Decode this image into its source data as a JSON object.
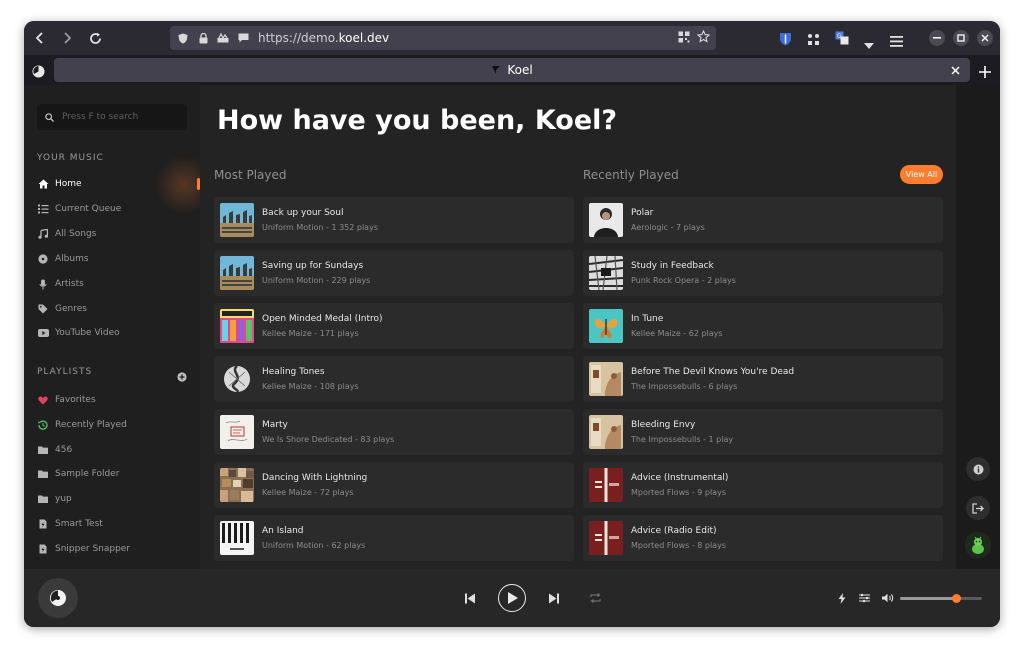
{
  "browser": {
    "url_prefix": "https://demo.",
    "url_host": "koel.dev",
    "tab_title": "Koel"
  },
  "sidebar": {
    "search_placeholder": "Press F to search",
    "your_music_title": "YOUR MUSIC",
    "music_items": [
      {
        "label": "Home",
        "icon": "home-icon"
      },
      {
        "label": "Current Queue",
        "icon": "queue-icon"
      },
      {
        "label": "All Songs",
        "icon": "music-note-icon"
      },
      {
        "label": "Albums",
        "icon": "disc-icon"
      },
      {
        "label": "Artists",
        "icon": "microphone-icon"
      },
      {
        "label": "Genres",
        "icon": "tag-icon"
      },
      {
        "label": "YouTube Video",
        "icon": "youtube-icon"
      }
    ],
    "playlists_title": "PLAYLISTS",
    "playlists": [
      {
        "label": "Favorites",
        "icon": "heart-icon"
      },
      {
        "label": "Recently Played",
        "icon": "history-icon"
      },
      {
        "label": "456",
        "icon": "folder-icon"
      },
      {
        "label": "Sample Folder",
        "icon": "folder-icon"
      },
      {
        "label": "yup",
        "icon": "folder-icon"
      },
      {
        "label": "Smart Test",
        "icon": "smart-playlist-icon"
      },
      {
        "label": "Snipper Snapper",
        "icon": "smart-playlist-icon"
      }
    ]
  },
  "main": {
    "greeting": "How have you been, Koel?",
    "most_played_title": "Most Played",
    "recently_played_title": "Recently Played",
    "view_all": "View All",
    "most_played": [
      {
        "title": "Back up your Soul",
        "sub": "Uniform Motion - 1 352 plays"
      },
      {
        "title": "Saving up for Sundays",
        "sub": "Uniform Motion - 229 plays"
      },
      {
        "title": "Open Minded Medal (Intro)",
        "sub": "Kellee Maize - 171 plays"
      },
      {
        "title": "Healing Tones",
        "sub": "Kellee Maize - 108 plays"
      },
      {
        "title": "Marty",
        "sub": "We Is Shore Dedicated - 83 plays"
      },
      {
        "title": "Dancing With Lightning",
        "sub": "Kellee Maize - 72 plays"
      },
      {
        "title": "An Island",
        "sub": "Uniform Motion - 62 plays"
      }
    ],
    "recently_played": [
      {
        "title": "Polar",
        "sub": "Aerologic - 7 plays"
      },
      {
        "title": "Study in Feedback",
        "sub": "Punk Rock Opera - 2 plays"
      },
      {
        "title": "In Tune",
        "sub": "Kellee Maize - 62 plays"
      },
      {
        "title": "Before The Devil Knows You're Dead",
        "sub": "The Impossebulls - 6 plays"
      },
      {
        "title": "Bleeding Envy",
        "sub": "The Impossebulls - 1 play"
      },
      {
        "title": "Advice (Instrumental)",
        "sub": "Mported Flows - 9 plays"
      },
      {
        "title": "Advice (Radio Edit)",
        "sub": "Mported Flows - 8 plays"
      }
    ]
  },
  "player": {
    "volume_level": 0.68
  },
  "colors": {
    "accent": "#ff7d2e",
    "favorites": "#e0445e",
    "recently_played": "#56c46a"
  }
}
